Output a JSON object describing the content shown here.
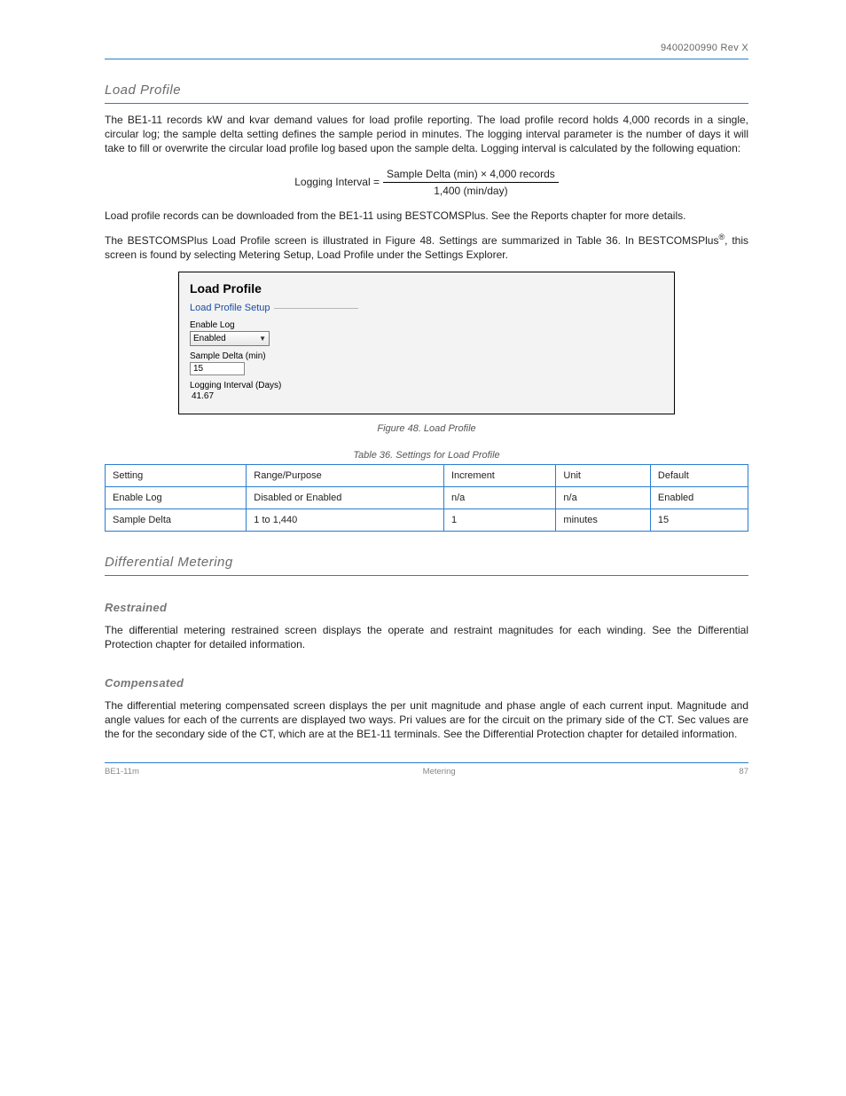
{
  "header": {
    "doc_ref": "9400200990 Rev X"
  },
  "section1": {
    "heading": "Load Profile",
    "p1": "The BE1-11 records kW and kvar demand values for load profile reporting. The load profile record holds 4,000 records in a single, circular log; the sample delta setting defines the sample period in minutes. The logging interval parameter is the number of days it will take to fill or overwrite the circular load profile log based upon the sample delta. Logging interval is calculated by the following equation:",
    "eq_left": "Logging Interval = ",
    "eq_numer": " Sample Delta (min) × 4,000 records",
    "eq_denom": "1,400 (min/day)",
    "p2": "Load profile records can be downloaded from the BE1-11 using BESTCOMSPlus. See the Reports chapter for more details.",
    "p3_a": "The BESTCOMSPlus Load Profile screen is illustrated in Figure 48. Settings are summarized in Table 36. In BESTCOMSPlus",
    "reg": "®",
    "p3_b": ", this screen is found by selecting Metering Setup, Load Profile under the Settings Explorer.",
    "panel": {
      "title": "Load Profile",
      "legend": "Load Profile Setup",
      "enable_label": "Enable Log",
      "enable_value": "Enabled",
      "sample_label": "Sample Delta (min)",
      "sample_value": "15",
      "interval_label": "Logging Interval (Days)",
      "interval_value": "41.67"
    },
    "figcap": "Figure 48. Load Profile",
    "tabcap": "Table 36. Settings for Load Profile",
    "table": {
      "headers": [
        "Setting",
        "Range/Purpose",
        "Increment",
        "Unit",
        "Default"
      ],
      "rows": [
        [
          "Enable Log",
          "Disabled or Enabled",
          "n/a",
          "n/a",
          "Enabled"
        ],
        [
          "Sample Delta",
          "1 to 1,440",
          "1",
          "minutes",
          "15"
        ]
      ]
    }
  },
  "section2": {
    "heading": "Differential Metering",
    "sub1": {
      "heading": "Restrained",
      "body": "The differential metering restrained screen displays the operate and restraint magnitudes for each winding. See the Differential Protection chapter for detailed information."
    },
    "sub2": {
      "heading": "Compensated",
      "body": "The differential metering compensated screen displays the per unit magnitude and phase angle of each current input. Magnitude and angle values for each of the currents are displayed two ways. Pri values are for the circuit on the primary side of the CT. Sec values are the for the secondary side of the CT, which are at the BE1-11 terminals. See the Differential Protection chapter for detailed information."
    }
  },
  "footer": {
    "left": "BE1-11m",
    "center": "Metering",
    "right": "87"
  }
}
